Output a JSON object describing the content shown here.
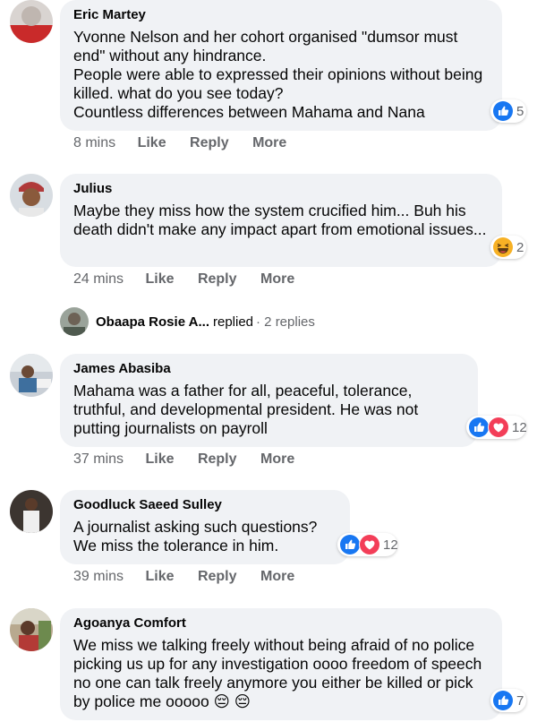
{
  "colors": {
    "bubble": "#f0f2f5",
    "meta_text": "#65676b",
    "like_blue": "#1877f2",
    "love_red": "#f33e58",
    "haha_yellow": "#f7b125"
  },
  "comments": [
    {
      "author": "Eric Martey",
      "lines": [
        "Yvonne Nelson and her cohort organised \"dumsor must end\" without any hindrance.",
        "People were able to expressed their opinions without being killed. what do you see today?",
        "Countless differences between Mahama and Nana"
      ],
      "time": "8 mins",
      "actions": [
        "Like",
        "Reply",
        "More"
      ],
      "reactions": [
        "like-icon"
      ],
      "reaction_count": "5"
    },
    {
      "author": "Julius",
      "lines": [
        "Maybe they miss how the system crucified him... Buh his death didn't make any impact apart from emotional issues..."
      ],
      "time": "24 mins",
      "actions": [
        "Like",
        "Reply",
        "More"
      ],
      "reactions": [
        "haha-icon"
      ],
      "reaction_count": "2"
    },
    {
      "author": "James Abasiba",
      "lines": [
        "Mahama was a father for all, peaceful, tolerance, truthful, and developmental president. He was not putting journalists on payroll"
      ],
      "time": "37 mins",
      "actions": [
        "Like",
        "Reply",
        "More"
      ],
      "reactions": [
        "like-icon",
        "love-icon"
      ],
      "reaction_count": "12"
    },
    {
      "author": "Goodluck Saeed Sulley",
      "lines": [
        "A journalist asking such questions?",
        "We miss the tolerance in him."
      ],
      "time": "39 mins",
      "actions": [
        "Like",
        "Reply",
        "More"
      ],
      "reactions": [
        "like-icon",
        "love-icon"
      ],
      "reaction_count": "12"
    },
    {
      "author": "Agoanya Comfort",
      "lines": [
        "We miss we talking freely without being afraid of no police picking us up for any investigation oooo freedom of speech no one can talk freely anymore you either be killed or pick by police me ooooo 😔 😔"
      ],
      "reactions": [
        "like-icon"
      ],
      "reaction_count": "7"
    }
  ],
  "reply_summary": {
    "name": "Obaapa Rosie A...",
    "verb": "replied",
    "count": "· 2 replies"
  }
}
